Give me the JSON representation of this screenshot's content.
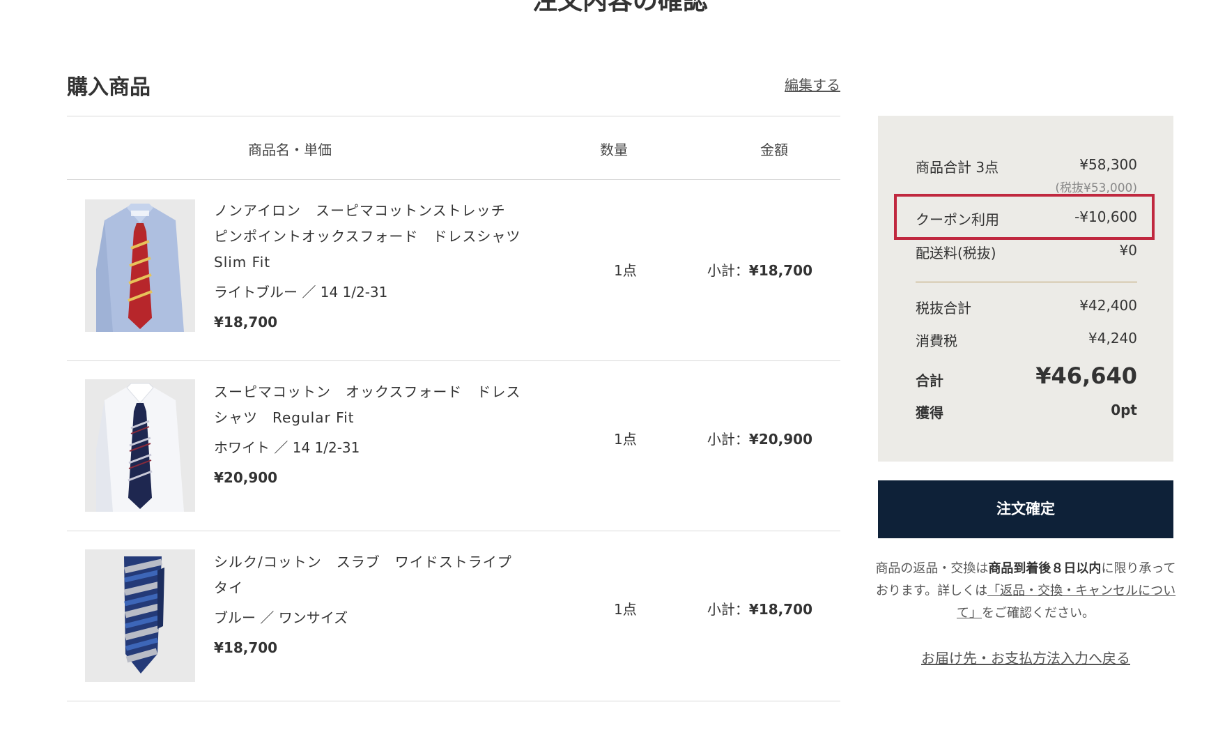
{
  "page_title": "注文内容の確認",
  "section": {
    "title": "購入商品",
    "edit_label": "編集する"
  },
  "table_headers": {
    "name": "商品名・単価",
    "qty": "数量",
    "amount": "金額"
  },
  "items": [
    {
      "name_line1": "ノンアイロン　スーピマコットンストレッチ",
      "name_line2": "ピンポイントオックスフォード　ドレスシャツ",
      "name_line3": "Slim Fit",
      "variant": "ライトブルー ／ 14 1/2-31",
      "price": "¥18,700",
      "qty": "1点",
      "subtotal_label": "小計：",
      "subtotal": "¥18,700",
      "image_icon": "blue-shirt-red-tie-image"
    },
    {
      "name_line1": "スーピマコットン　オックスフォード　ドレス",
      "name_line2": "シャツ　Regular Fit",
      "variant": "ホワイト ／ 14 1/2-31",
      "price": "¥20,900",
      "qty": "1点",
      "subtotal_label": "小計：",
      "subtotal": "¥20,900",
      "image_icon": "white-shirt-navy-tie-image"
    },
    {
      "name_line1": "シルク/コットン　スラブ　ワイドストライプ",
      "name_line2": "タイ",
      "variant": "ブルー ／ ワンサイズ",
      "price": "¥18,700",
      "qty": "1点",
      "subtotal_label": "小計：",
      "subtotal": "¥18,700",
      "image_icon": "blue-striped-tie-image"
    }
  ],
  "summary": {
    "items_total_label": "商品合計 3点",
    "items_total": "¥58,300",
    "items_total_excl_tax": "(税抜¥53,000)",
    "coupon_label": "クーポン利用",
    "coupon_value": "-¥10,600",
    "shipping_label": "配送料(税抜)",
    "shipping_value": "¥0",
    "subtotal_excl_label": "税抜合計",
    "subtotal_excl_value": "¥42,400",
    "tax_label": "消費税",
    "tax_value": "¥4,240",
    "total_label": "合計",
    "total_value": "¥46,640",
    "points_label": "獲得",
    "points_value": "0pt",
    "highlight_color": "#c0283f",
    "panel_color": "#ecebe7"
  },
  "confirm_button_label": "注文確定",
  "notice": {
    "part1": "商品の返品・交換は",
    "bold": "商品到着後８日以内",
    "part2": "に限り承っております。詳しくは",
    "link": "「返品・交換・キャンセルについて」",
    "part3": "をご確認ください。"
  },
  "back_link": "お届け先・お支払方法入力へ戻る"
}
